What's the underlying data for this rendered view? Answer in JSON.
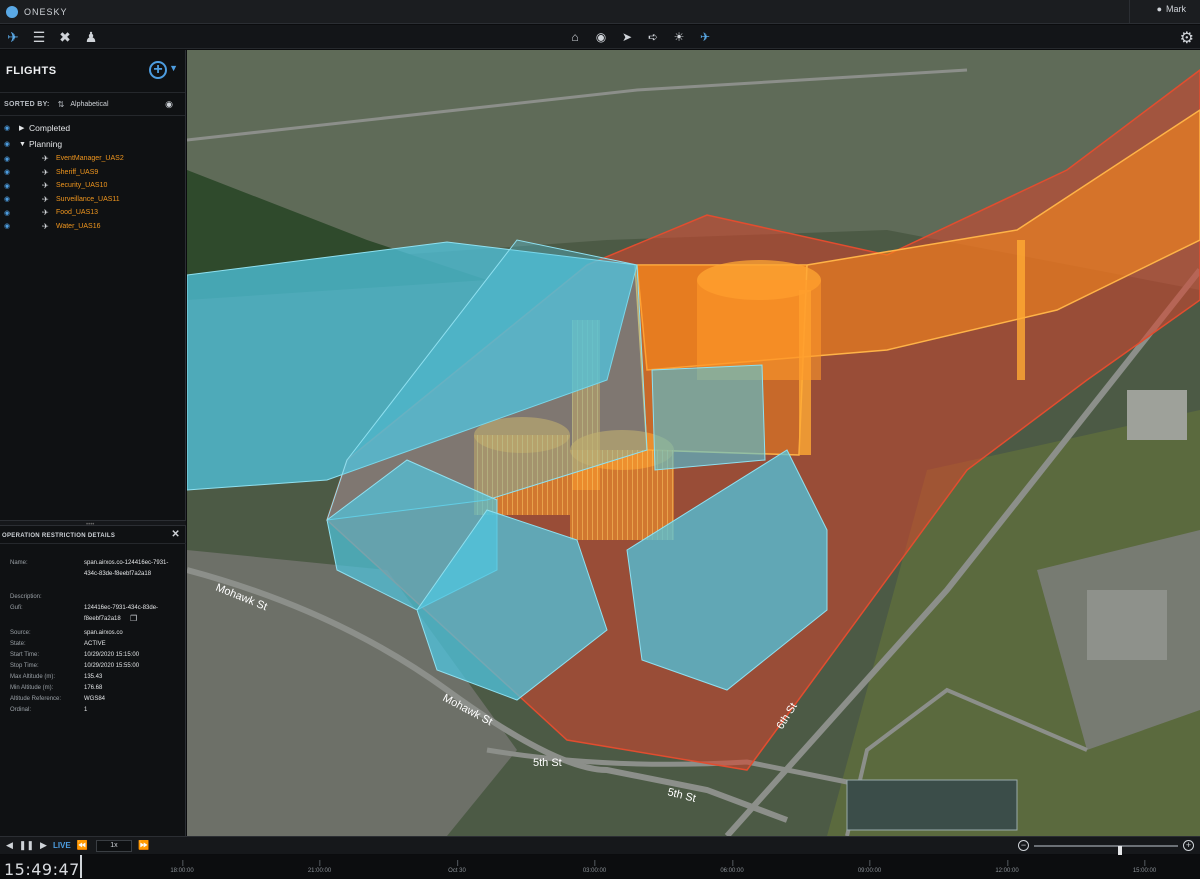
{
  "app": {
    "name": "ONESKY",
    "user": "Mark"
  },
  "toolbar": {
    "left_icons": [
      "flights-icon",
      "layers-icon",
      "tools-icon",
      "user-icon"
    ],
    "center_icons": [
      "home-icon",
      "pin-drop-icon",
      "pushpin-icon",
      "navigate-icon",
      "sun-icon",
      "plane-icon"
    ]
  },
  "flights_panel": {
    "title": "FLIGHTS",
    "sorted_by_label": "SORTED BY:",
    "sorted_by_value": "Alphabetical",
    "groups": [
      {
        "label": "Completed",
        "expanded": false
      },
      {
        "label": "Planning",
        "expanded": true
      }
    ],
    "flights": [
      "EventManager_UAS2",
      "Sheriff_UAS9",
      "Security_UAS10",
      "Surveillance_UAS11",
      "Food_UAS13",
      "Water_UAS16"
    ]
  },
  "details": {
    "title": "OPERATION RESTRICTION DETAILS",
    "fields": [
      {
        "label": "Name:",
        "value": "span.airxos.co-124416ec-7931-434c-83de-f8eebf7a2a18"
      },
      {
        "label": "Description:",
        "value": ""
      },
      {
        "label": "Gufi:",
        "value": "124416ec-7931-434c-83de-f8eebf7a2a18"
      },
      {
        "label": "Source:",
        "value": "span.airxos.co"
      },
      {
        "label": "State:",
        "value": "ACTIVE"
      },
      {
        "label": "Start Time:",
        "value": "10/29/2020 15:15:00"
      },
      {
        "label": "Stop Time:",
        "value": "10/29/2020 15:55:00"
      },
      {
        "label": "Max Altitude (m):",
        "value": "135.43"
      },
      {
        "label": "Min Altitude (m):",
        "value": "176.68"
      },
      {
        "label": "Altitude Reference:",
        "value": "WGS84"
      },
      {
        "label": "Ordinal:",
        "value": "1"
      }
    ]
  },
  "map_labels": {
    "streets": [
      "Mohawk St",
      "Mohawk St",
      "5th St",
      "5th St",
      "6th St"
    ]
  },
  "playback": {
    "live_label": "LIVE",
    "speed": "1x",
    "zoom_level": 0.6
  },
  "timeline": {
    "clock": "15:49:47",
    "ticks": [
      "18:00:00",
      "21:00:00",
      "Oct 30",
      "03:00:00",
      "06:00:00",
      "09:00:00",
      "12:00:00",
      "15:00:00"
    ]
  },
  "colors": {
    "accent": "#4d9de0",
    "flight_text": "#f0961e",
    "zone_blue": "#4fc6e0",
    "zone_orange": "#ff8c1a",
    "zone_red": "#d9432b"
  }
}
